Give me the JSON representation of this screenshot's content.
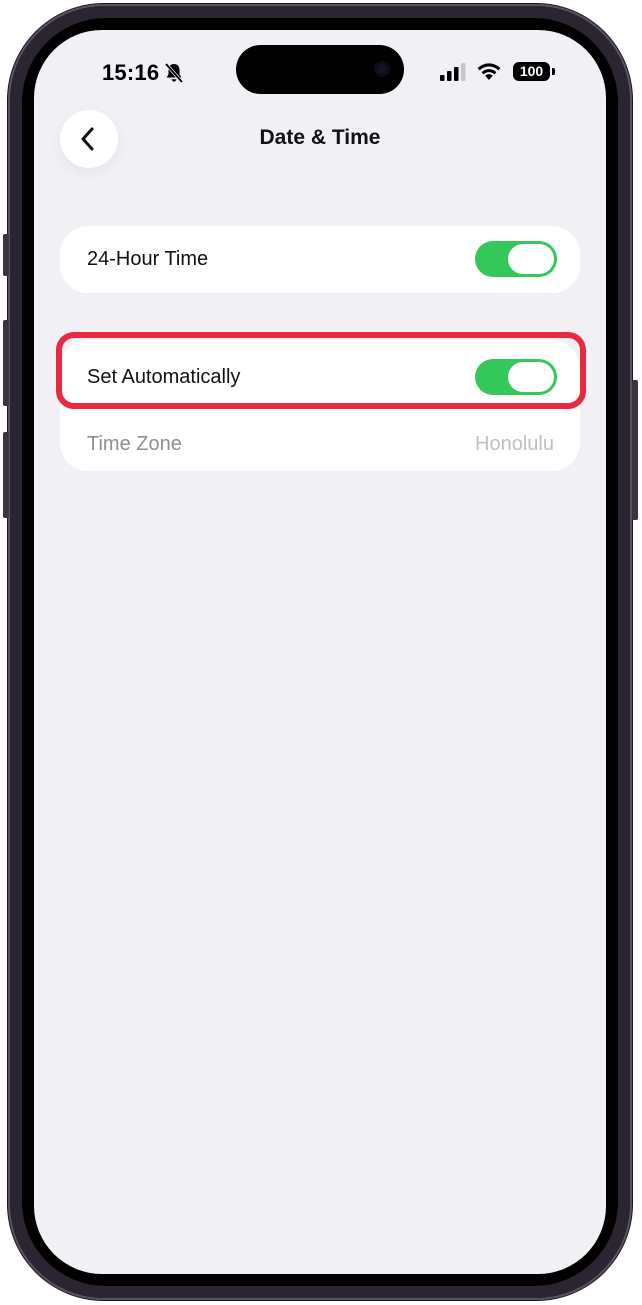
{
  "status_bar": {
    "time": "15:16",
    "battery": "100",
    "icons": [
      "bell-slash-icon",
      "signal-icon",
      "wifi-icon",
      "battery-icon"
    ]
  },
  "nav": {
    "title": "Date & Time",
    "back_icon": "chevron-left-icon"
  },
  "settings": {
    "hour24": {
      "label": "24-Hour Time",
      "on": true
    },
    "set_automatically": {
      "label": "Set Automatically",
      "on": true
    },
    "time_zone": {
      "label": "Time Zone",
      "value": "Honolulu"
    }
  },
  "colors": {
    "toggle_on": "#34c759",
    "highlight": "#ea2940",
    "background": "#f1f0f5"
  }
}
